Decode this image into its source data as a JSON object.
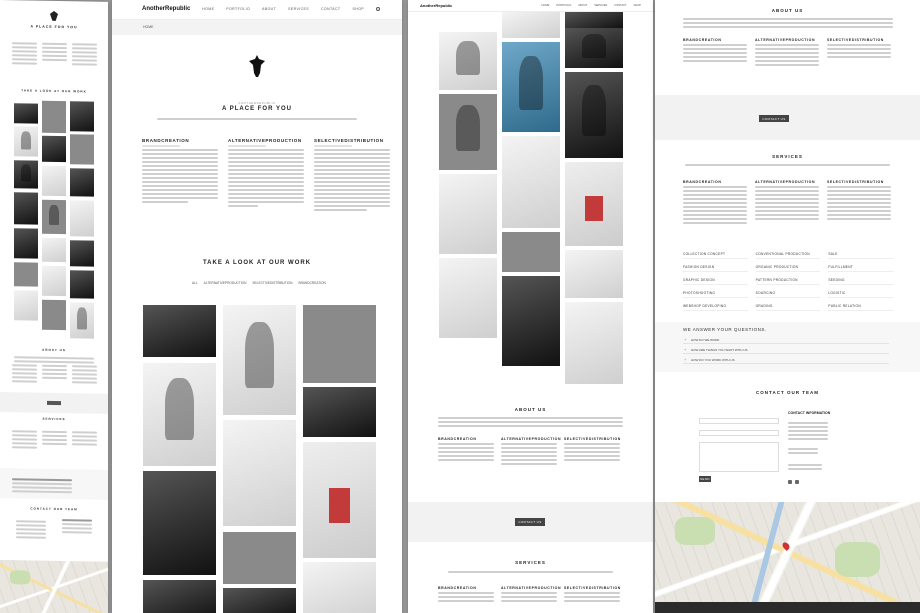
{
  "brand": {
    "logo": "AnotherRepublic"
  },
  "nav": {
    "items": [
      "HOME",
      "PORTFOLIO",
      "ABOUT",
      "SERVICES",
      "CONTACT",
      "SHOP"
    ]
  },
  "breadcrumb": {
    "label": "HOME"
  },
  "intro": {
    "title": "A PLACE FOR YOU",
    "subtitle": "ANOTHERREPUBLIC"
  },
  "columns": [
    {
      "title": "BRANDCREATION"
    },
    {
      "title": "ALTERNATIVEPRODUCTION"
    },
    {
      "title": "SELECTIVEDISTRIBUTION"
    }
  ],
  "portfolio": {
    "title": "TAKE A LOOK AT OUR WORK",
    "filters": [
      "ALL",
      "ALTERNATIVEPRODUCTION",
      "SELECTIVEDISTRIBUTION",
      "BRANDCREATION"
    ]
  },
  "about": {
    "title": "ABOUT US",
    "button": "CONTACT US"
  },
  "services": {
    "title": "SERVICES",
    "items": [
      "COLLECTION CONCEPT",
      "CONVENTIONAL PRODUCTION",
      "SALE",
      "FASHION DESIGN",
      "ORGANIC PRODUCTION",
      "FULFILLMENT",
      "GRAPHIC DESIGN",
      "PATTERN PRODUCTION",
      "SEEDING",
      "PHOTOSHOOTING",
      "SOURCING",
      "LOGISTIC",
      "WEBSHOP DEVELOPING",
      "GRADING",
      "PUBLIC RELATION"
    ]
  },
  "faq": {
    "title": "WE ANSWER YOUR QUESTIONS.",
    "items": [
      "HOW DO WE WORK",
      "HOW ARE THINGS YOU WANT WITH US",
      "HOW DO YOU WORK WITH US"
    ]
  },
  "contact": {
    "title": "CONTACT OUR TEAM",
    "info_title": "CONTACT INFORMATION",
    "send": "SEND"
  }
}
